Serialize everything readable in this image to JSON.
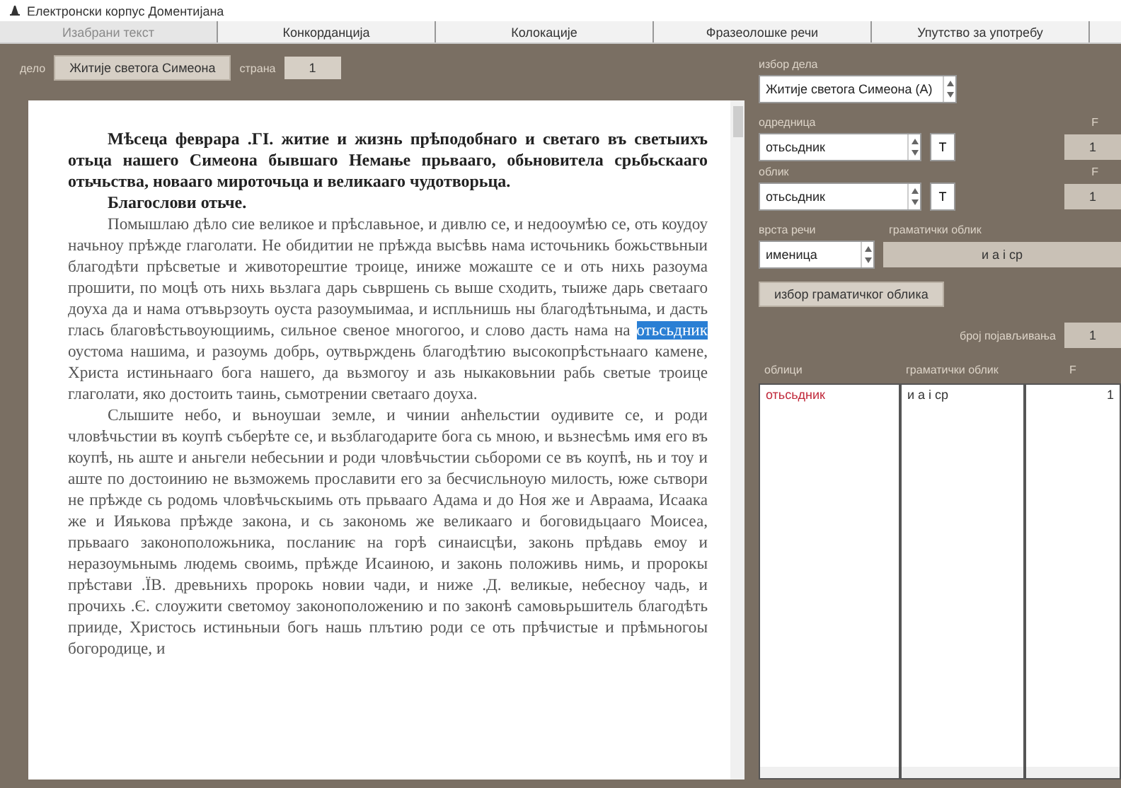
{
  "window": {
    "title": "Електронски корпус Доментијана"
  },
  "tabs": [
    {
      "label": "Изабрани текст",
      "selected": true
    },
    {
      "label": "Конкорданција",
      "selected": false
    },
    {
      "label": "Колокације",
      "selected": false
    },
    {
      "label": "Фразеолошке речи",
      "selected": false
    },
    {
      "label": "Упутство за употребу",
      "selected": false
    }
  ],
  "work_bar": {
    "work_label": "дело",
    "work_button": "Житије светога Симеона",
    "page_label": "страна",
    "page_value": "1"
  },
  "text": {
    "paragraphs": [
      {
        "kind": "heading",
        "segments": [
          {
            "text": "Мѣсеца феврара .ГІ. житие и жизнь прѣподобнаго и светаго въ светыихъ отьца нашего Симеона бывшаго Немање прьвааго, обьновитела срьбьскааго отьчьства, новааго мироточьца и великааго чудотворьца.",
            "highlighted": false
          }
        ]
      },
      {
        "kind": "heading",
        "segments": [
          {
            "text": "Благослови отьче.",
            "highlighted": false
          }
        ]
      },
      {
        "kind": "body",
        "segments": [
          {
            "text": "Помышлаю дѣло сие великое и прѣславьное, и дивлю се, и недооумѣю се, оть коудоу начьноу прѣжде глаголати. Не обидитии не прѣжда высѣвь нама источьникь божьствьныи благодѣти прѣсветые и животорештие троице, иниже можаште се и оть нихь разоума прошити, по моцѣ оть нихь вьзлага дарь сьвршень сь выше сходить, тыиже дарь светааго доуха да и нама отъвьрзоуть оуста разоумыимаа, и испльнишь ны благодѣтьныма, и дасть глась благовѣстьвоующиимь, сильное свеное многогоо, и слово дасть нама на ",
            "highlighted": false
          },
          {
            "text": "отьсьдник",
            "highlighted": true
          },
          {
            "text": " оустома нашима, и разоумь добрь, оутвьрждень благодѣтию высокопрѣстьнааго камене, Христа истиньнааго бога нашего, да вьзмогоу и азь ныкаковьнии рабь светые троице глаголати, яко достоить таинь, сьмотрении светааго доуха.",
            "highlighted": false
          }
        ]
      },
      {
        "kind": "body",
        "segments": [
          {
            "text": "Слышите небо, и вьноушаи земле, и чинии анћельстии оудивите се, и роди чловѣчьстии въ коупѣ съберѣте се, и вьзблагодарите бога сь мною, и вьзнесѣмь имя его въ коупѣ, нь аште и аньгели небесьнии и роди чловѣчьстии сьбороми се въ коупѣ, нь и тоу и аште по достоинию не вьзможемь прославити его за бесчисльноую милость, юже сьтвори не прѣжде сь родомь чловѣчьскыимь оть прьвааго Адама и до Ноя же и Авраама, Исаака же и Ияькова прѣжде закона, и сь закономь же великааго и боговидьцааго Моисеа, прьвааго законоположьника, посланиѥ на горѣ синаисцѣи, законь прѣдавь емоу и неразоумьнымь людемь своимь, прѣжде Исаиною, и законь положивь нимь, и пророкы прѣстави .ЇВ. древьнихь пророкь новии чади, и ниже .Д. великые, небесноу чадь, и прочихь .Є. слоужити светомоу законоположению и по законѣ самовьрьшитель благодѣть прииде, Христось истиньныи богь нашь плътию роди се оть прѣчистые и прѣмьногоы богородице, и",
            "highlighted": false
          }
        ]
      }
    ]
  },
  "search": {
    "work_label": "избор дела",
    "work_value": "Житије светога Симеона (А)",
    "lemma_label": "одредница",
    "lemma_f_label": "F",
    "lemma_value": "отьсьдник",
    "lemma_t": "Т",
    "lemma_count": "1",
    "form_label": "облик",
    "form_f_label": "F",
    "form_value": "отьсьдник",
    "form_t": "Т",
    "form_count": "1",
    "pos_label": "врста речи",
    "pos_value": "именица",
    "gram_label": "граматички облик",
    "gram_value": "и а і ср",
    "gram_button": "избор граматичког облика",
    "occ_label": "број појављивања",
    "occ_value": "1"
  },
  "table": {
    "columns": [
      "облици",
      "граматички облик",
      "F"
    ],
    "rows": [
      {
        "form": "отьсьдник",
        "gram": "и а і ср",
        "count": "1",
        "selected": true
      }
    ]
  }
}
